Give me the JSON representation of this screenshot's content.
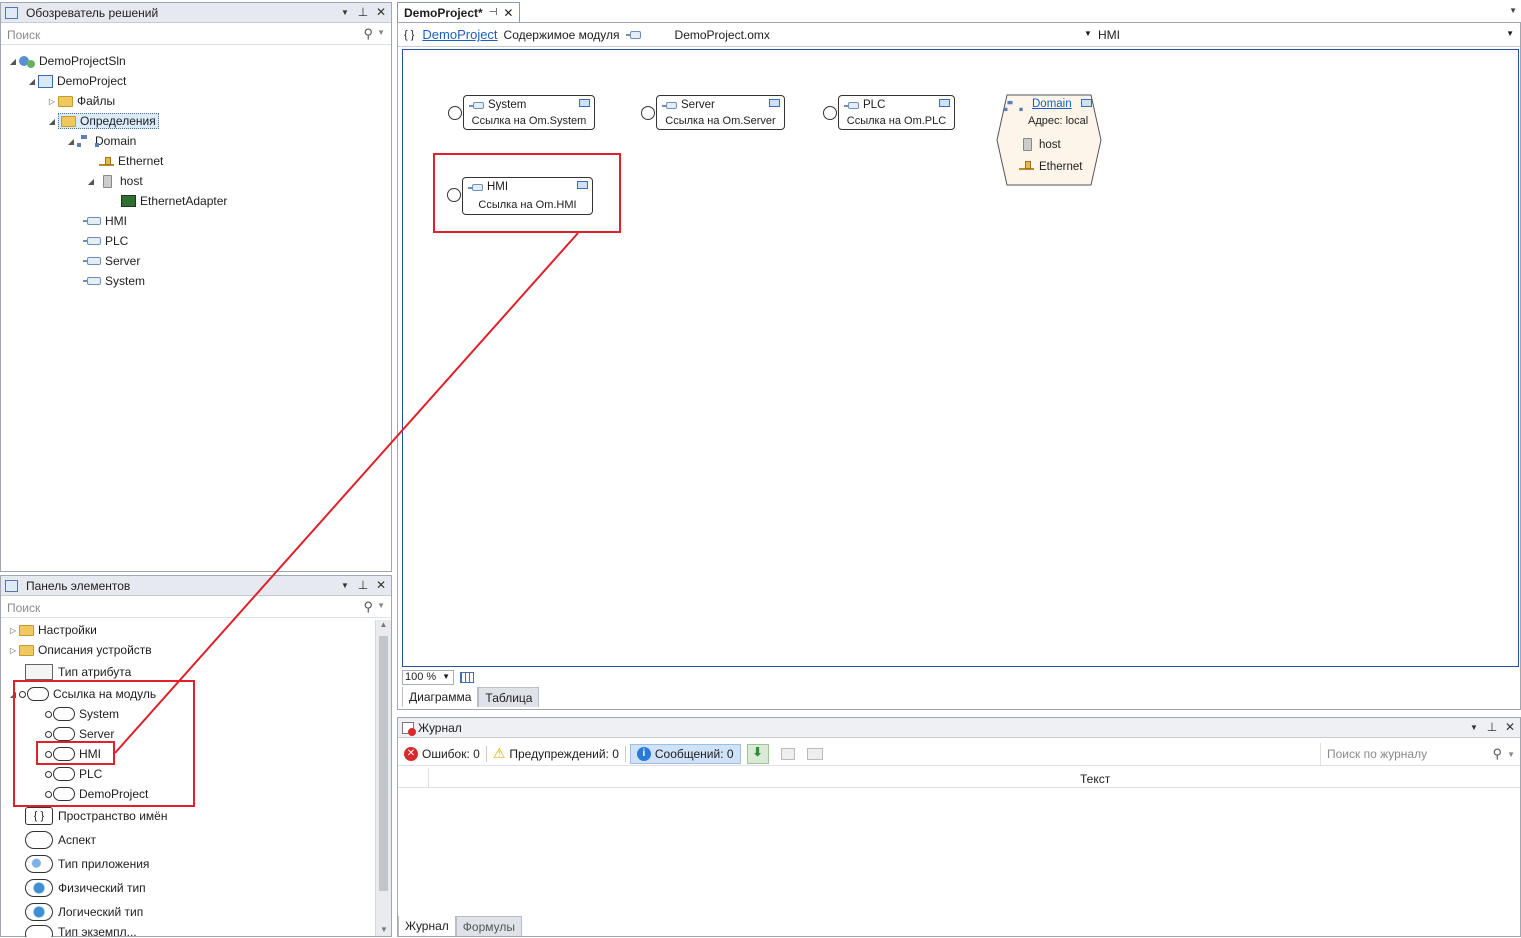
{
  "solution_explorer": {
    "title": "Обозреватель решений",
    "search_placeholder": "Поиск",
    "tree": {
      "solution": "DemoProjectSln",
      "project": "DemoProject",
      "files": "Файлы",
      "definitions": "Определения",
      "domain": "Domain",
      "ethernet": "Ethernet",
      "host": "host",
      "adapter": "EthernetAdapter",
      "hmi": "HMI",
      "plc": "PLC",
      "server": "Server",
      "system": "System"
    }
  },
  "toolbox": {
    "title": "Панель элементов",
    "search_placeholder": "Поиск",
    "items": {
      "settings": "Настройки",
      "device_desc": "Описания устройств",
      "attr_type": "Тип атрибута",
      "module_ref": "Ссылка на модуль",
      "sub_system": "System",
      "sub_server": "Server",
      "sub_hmi": "HMI",
      "sub_plc": "PLC",
      "sub_demoproject": "DemoProject",
      "namespace": "Пространство имён",
      "aspect": "Аспект",
      "app_type": "Тип приложения",
      "phys_type": "Физический тип",
      "logic_type": "Логический тип",
      "cut_item": "Тип экземпл..."
    }
  },
  "document": {
    "tab_label": "DemoProject*",
    "breadcrumb_link": "DemoProject",
    "breadcrumb_text": "Содержимое модуля",
    "file": "DemoProject.omx",
    "selected_node": "HMI",
    "zoom": "100 %",
    "bottom_tabs": [
      "Диаграмма",
      "Таблица"
    ]
  },
  "diagram": {
    "nodes": {
      "system": {
        "title": "System",
        "sub": "Ссылка на Om.System"
      },
      "server": {
        "title": "Server",
        "sub": "Ссылка на Om.Server"
      },
      "plc": {
        "title": "PLC",
        "sub": "Ссылка на Om.PLC"
      },
      "hmi": {
        "title": "HMI",
        "sub": "Ссылка на Om.HMI"
      }
    },
    "domain": {
      "title": "Domain",
      "address": "Адрес: local",
      "items": [
        "host",
        "Ethernet"
      ]
    }
  },
  "journal": {
    "title": "Журнал",
    "errors": "Ошибок: 0",
    "warnings": "Предупреждений: 0",
    "messages": "Сообщений: 0",
    "search_placeholder": "Поиск по журналу",
    "col_text": "Текст",
    "bottom_tabs": [
      "Журнал",
      "Формулы"
    ]
  },
  "colors": {
    "highlight": "#e0202a",
    "link": "#1e5dbe",
    "panel_title": "#e6e9ef"
  }
}
